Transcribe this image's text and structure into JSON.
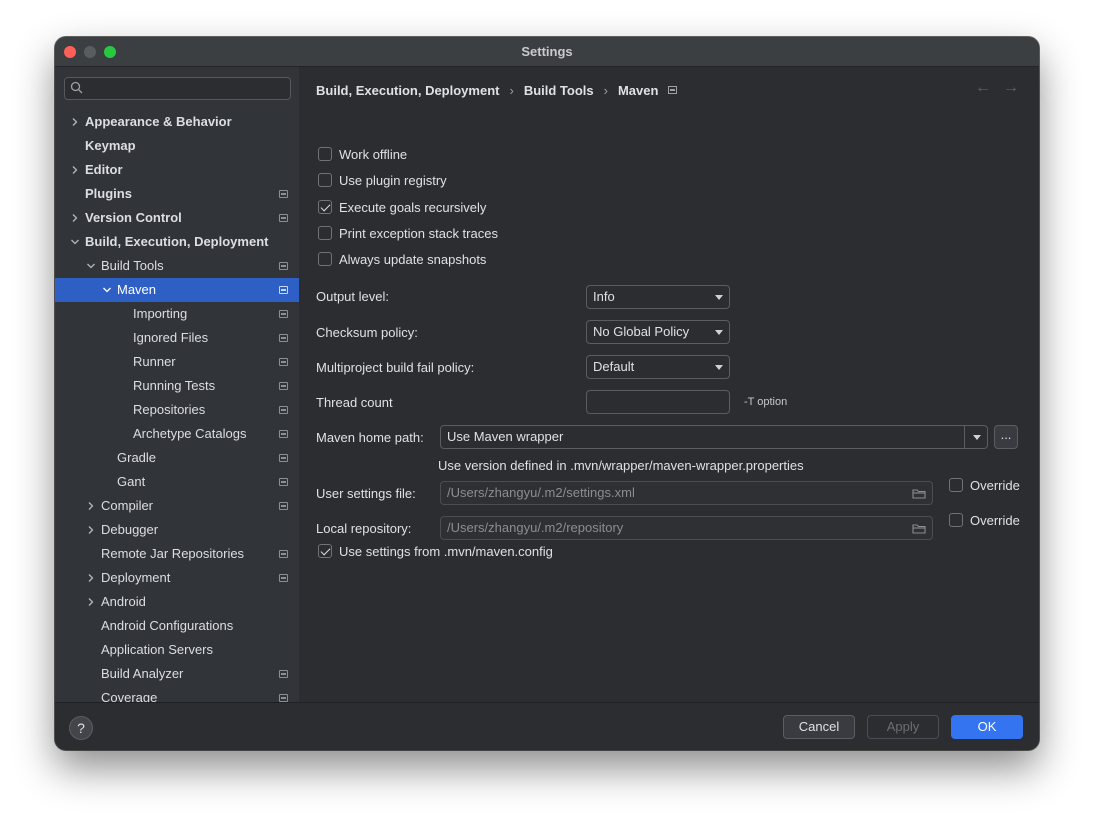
{
  "window": {
    "title": "Settings"
  },
  "search": {
    "placeholder": ""
  },
  "sidebar": {
    "items": [
      {
        "label": "Appearance & Behavior",
        "expandable": true,
        "expanded": false,
        "bold": true,
        "project": false
      },
      {
        "label": "Keymap",
        "expandable": false,
        "bold": true,
        "project": false
      },
      {
        "label": "Editor",
        "expandable": true,
        "expanded": false,
        "bold": true,
        "project": false
      },
      {
        "label": "Plugins",
        "expandable": false,
        "bold": true,
        "project": true
      },
      {
        "label": "Version Control",
        "expandable": true,
        "expanded": false,
        "bold": true,
        "project": true
      },
      {
        "label": "Build, Execution, Deployment",
        "expandable": true,
        "expanded": true,
        "bold": true,
        "project": false
      },
      {
        "label": "Build Tools",
        "expandable": true,
        "expanded": true,
        "bold": false,
        "project": true
      },
      {
        "label": "Maven",
        "expandable": true,
        "expanded": true,
        "bold": false,
        "project": true,
        "selected": true
      },
      {
        "label": "Importing",
        "expandable": false,
        "bold": false,
        "project": true
      },
      {
        "label": "Ignored Files",
        "expandable": false,
        "bold": false,
        "project": true
      },
      {
        "label": "Runner",
        "expandable": false,
        "bold": false,
        "project": true
      },
      {
        "label": "Running Tests",
        "expandable": false,
        "bold": false,
        "project": true
      },
      {
        "label": "Repositories",
        "expandable": false,
        "bold": false,
        "project": true
      },
      {
        "label": "Archetype Catalogs",
        "expandable": false,
        "bold": false,
        "project": true
      },
      {
        "label": "Gradle",
        "expandable": false,
        "bold": false,
        "project": true
      },
      {
        "label": "Gant",
        "expandable": false,
        "bold": false,
        "project": true
      },
      {
        "label": "Compiler",
        "expandable": true,
        "expanded": false,
        "bold": false,
        "project": true
      },
      {
        "label": "Debugger",
        "expandable": true,
        "expanded": false,
        "bold": false,
        "project": false
      },
      {
        "label": "Remote Jar Repositories",
        "expandable": false,
        "bold": false,
        "project": true
      },
      {
        "label": "Deployment",
        "expandable": true,
        "expanded": false,
        "bold": false,
        "project": true
      },
      {
        "label": "Android",
        "expandable": true,
        "expanded": false,
        "bold": false,
        "project": false
      },
      {
        "label": "Android Configurations",
        "expandable": false,
        "bold": false,
        "project": false
      },
      {
        "label": "Application Servers",
        "expandable": false,
        "bold": false,
        "project": false
      },
      {
        "label": "Build Analyzer",
        "expandable": false,
        "bold": false,
        "project": true
      },
      {
        "label": "Coverage",
        "expandable": false,
        "bold": false,
        "project": true
      }
    ]
  },
  "breadcrumb": {
    "part1": "Build, Execution, Deployment",
    "part2": "Build Tools",
    "part3": "Maven"
  },
  "checkboxes": {
    "work_offline": {
      "label": "Work offline",
      "checked": false
    },
    "plugin_registry": {
      "label": "Use plugin registry",
      "checked": false
    },
    "execute_recursive": {
      "label": "Execute goals recursively",
      "checked": true
    },
    "print_exception": {
      "label": "Print exception stack traces",
      "checked": false
    },
    "always_update": {
      "label": "Always update snapshots",
      "checked": false
    },
    "use_mvn_config": {
      "label": "Use settings from .mvn/maven.config",
      "checked": true
    }
  },
  "fields": {
    "output_level": {
      "label": "Output level:",
      "value": "Info"
    },
    "checksum_policy": {
      "label": "Checksum policy:",
      "value": "No Global Policy"
    },
    "fail_policy": {
      "label": "Multiproject build fail policy:",
      "value": "Default"
    },
    "thread_count": {
      "label": "Thread count",
      "value": "",
      "hint": "-T option"
    },
    "maven_home": {
      "label": "Maven home path:",
      "value": "Use Maven wrapper",
      "browse": "...",
      "info": "Use version defined in .mvn/wrapper/maven-wrapper.properties"
    },
    "user_settings": {
      "label": "User settings file:",
      "value": "/Users/zhangyu/.m2/settings.xml",
      "override": "Override"
    },
    "local_repo": {
      "label": "Local repository:",
      "value": "/Users/zhangyu/.m2/repository",
      "override": "Override"
    }
  },
  "buttons": {
    "help": "?",
    "cancel": "Cancel",
    "apply": "Apply",
    "ok": "OK"
  },
  "colors": {
    "accent": "#3574f0",
    "selection": "#2e5fc4",
    "background": "#2b2d30",
    "sidebar": "#313438"
  }
}
